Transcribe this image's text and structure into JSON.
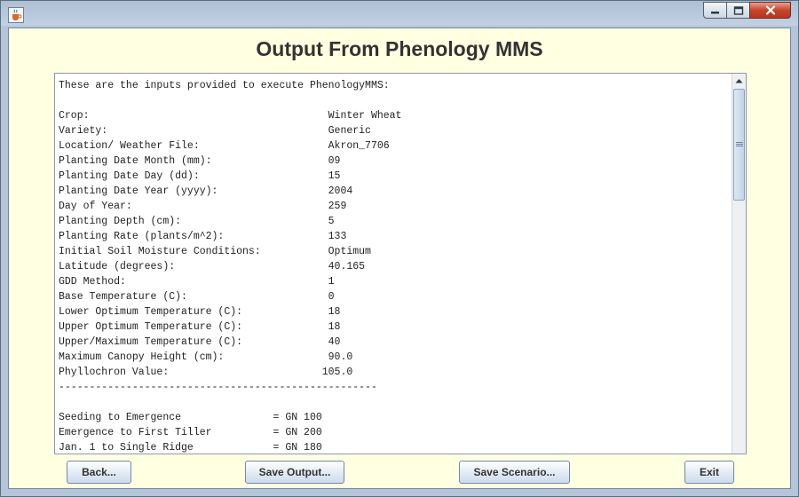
{
  "window": {
    "app_icon": "java-cup-icon",
    "controls": {
      "minimize_icon": "minimize-icon",
      "maximize_icon": "maximize-icon",
      "close_icon": "close-icon"
    }
  },
  "page": {
    "title": "Output From Phenology MMS"
  },
  "output": {
    "text": "These are the inputs provided to execute PhenologyMMS:\n\nCrop:                                       Winter Wheat\nVariety:                                    Generic\nLocation/ Weather File:                     Akron_7706\nPlanting Date Month (mm):                   09\nPlanting Date Day (dd):                     15\nPlanting Date Year (yyyy):                  2004\nDay of Year:                                259\nPlanting Depth (cm):                        5\nPlanting Rate (plants/m^2):                 133\nInitial Soil Moisture Conditions:           Optimum\nLatitude (degrees):                         40.165\nGDD Method:                                 1\nBase Temperature (C):                       0\nLower Optimum Temperature (C):              18\nUpper Optimum Temperature (C):              18\nUpper/Maximum Temperature (C):              40\nMaximum Canopy Height (cm):                 90.0\nPhyllochron Value:                         105.0\n----------------------------------------------------\n\nSeeding to Emergence               = GN 100\nEmergence to First Tiller          = GN 200\nJan. 1 to Single Ridge             = GN 180"
  },
  "scrollbar": {
    "up_icon": "scroll-up-arrow-icon",
    "thumb_icon": "scroll-grip-icon"
  },
  "buttons": {
    "back": "Back...",
    "save_output": "Save Output...",
    "save_scenario": "Save Scenario...",
    "exit": "Exit"
  }
}
